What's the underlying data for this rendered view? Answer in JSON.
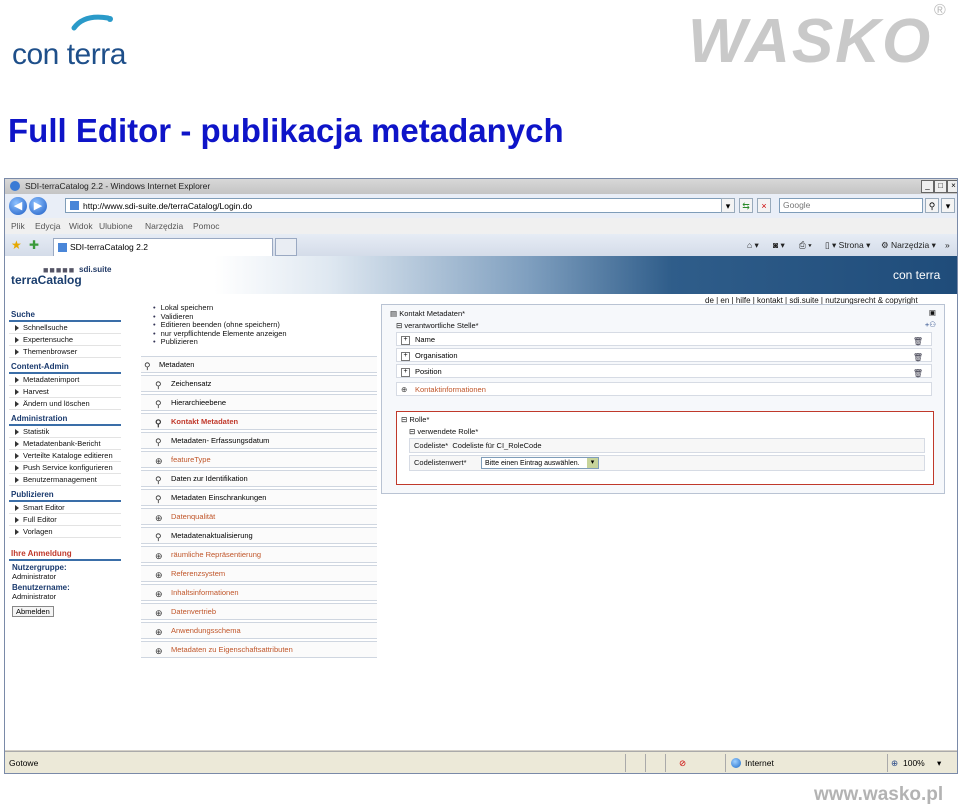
{
  "slide": {
    "title": "Full Editor - publikacja metadanych",
    "logo_left": "con terra",
    "logo_right": "WASKO",
    "registered_mark": "®",
    "footer_url": "www.wasko.pl"
  },
  "browser": {
    "window_title": "SDI-terraCatalog 2.2 - Windows Internet Explorer",
    "address": "http://www.sdi-suite.de/terraCatalog/Login.do",
    "search_placeholder": "Google",
    "menu": [
      "Plik",
      "Edycja",
      "Widok",
      "Ulubione",
      "Narzędzia",
      "Pomoc"
    ],
    "tab_label": "SDI-terraCatalog 2.2",
    "toolbar": {
      "page_label": "Strona",
      "tools_label": "Narzędzia"
    },
    "status": {
      "left": "Gotowe",
      "zone": "Internet",
      "zoom": "100%"
    }
  },
  "app": {
    "suite": "sdi.suite",
    "dots": "■■■■■",
    "title": "terraCatalog",
    "vendor": "con terra",
    "toplinks": "de | en | hilfe | kontakt | sdi.suite | nutzungsrecht & copyright"
  },
  "nav": {
    "sections": [
      {
        "title": "Suche",
        "items": [
          "Schnellsuche",
          "Expertensuche",
          "Themenbrowser"
        ]
      },
      {
        "title": "Content-Admin",
        "items": [
          "Metadatenimport",
          "Harvest",
          "Ändern und löschen"
        ]
      },
      {
        "title": "Administration",
        "items": [
          "Statistik",
          "Metadatenbank-Bericht",
          "Verteilte Kataloge editieren",
          "Push Service konfigurieren",
          "Benutzermanagement"
        ]
      },
      {
        "title": "Publizieren",
        "items": [
          "Smart Editor",
          "Full Editor",
          "Vorlagen"
        ]
      }
    ],
    "login": {
      "title": "Ihre Anmeldung",
      "group_label": "Nutzergruppe:",
      "group_value": "Administrator",
      "user_label": "Benutzername:",
      "user_value": "Administrator",
      "logout": "Abmelden"
    }
  },
  "actions": [
    "Lokal speichern",
    "Validieren",
    "Editieren beenden (ohne speichern)",
    "nur verpflichtende Elemente anzeigen",
    "Publizieren"
  ],
  "midlist": [
    {
      "label": "Metadaten",
      "style": "head",
      "icon": "search"
    },
    {
      "label": "Zeichensatz",
      "style": "normal",
      "icon": "search"
    },
    {
      "label": "Hierarchieebene",
      "style": "normal",
      "icon": "search"
    },
    {
      "label": "Kontakt Metadaten",
      "style": "orange-bold",
      "icon": "search"
    },
    {
      "label": "Metadaten- Erfassungsdatum",
      "style": "normal",
      "icon": "search"
    },
    {
      "label": "featureType",
      "style": "orange",
      "icon": "add"
    },
    {
      "label": "Daten zur Identifikation",
      "style": "normal",
      "icon": "search"
    },
    {
      "label": "Metadaten Einschrankungen",
      "style": "normal",
      "icon": "search"
    },
    {
      "label": "Datenqualität",
      "style": "orange",
      "icon": "add"
    },
    {
      "label": "Metadatenaktualisierung",
      "style": "normal",
      "icon": "search"
    },
    {
      "label": "räumliche Repräsentierung",
      "style": "orange",
      "icon": "add"
    },
    {
      "label": "Referenzsystem",
      "style": "orange",
      "icon": "add"
    },
    {
      "label": "Inhaltsinformationen",
      "style": "orange",
      "icon": "add"
    },
    {
      "label": "Datenvertrieb",
      "style": "orange",
      "icon": "add"
    },
    {
      "label": "Anwendungsschema",
      "style": "orange",
      "icon": "add"
    },
    {
      "label": "Metadaten zu Eigenschaftsattributen",
      "style": "orange",
      "icon": "add"
    }
  ],
  "detail": {
    "header": "Kontakt Metadaten*",
    "responsible": "verantwortliche Stelle*",
    "rows": [
      "Name",
      "Organisation",
      "Position"
    ],
    "contact_info": "Kontaktinformationen",
    "role_header": "Rolle*",
    "role_used": "verwendete Rolle*",
    "codelist_label": "Codeliste*",
    "codelist_value": "Codeliste für CI_RoleCode",
    "codelist_value_label": "Codelistenwert*",
    "select_value": "Bitte einen Eintrag auswählen."
  },
  "colors": {
    "slide_title": "#0e14c8",
    "nav_accent": "#3a6ea8",
    "orange_link": "#c0562a",
    "role_border": "#c0392b"
  }
}
